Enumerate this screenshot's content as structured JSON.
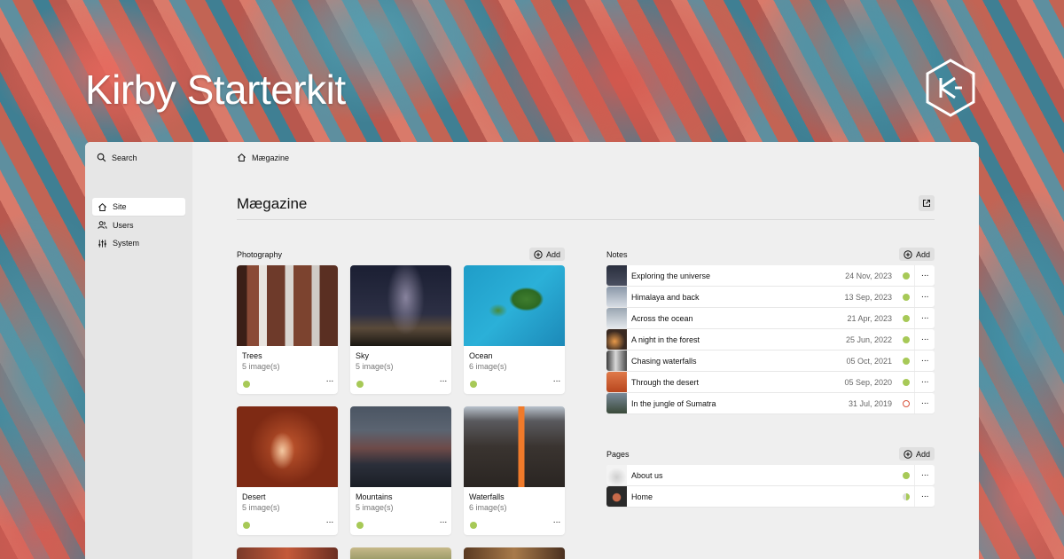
{
  "hero": {
    "title": "Kirby Starterkit"
  },
  "sidebar": {
    "search_label": "Search",
    "items": [
      {
        "label": "Site",
        "icon": "home-icon",
        "active": true
      },
      {
        "label": "Users",
        "icon": "users-icon",
        "active": false
      },
      {
        "label": "System",
        "icon": "settings-sliders-icon",
        "active": false
      }
    ]
  },
  "breadcrumb": {
    "label": "Mægazine"
  },
  "page": {
    "title": "Mægazine"
  },
  "photography": {
    "label": "Photography",
    "add_label": "Add",
    "cards": [
      {
        "title": "Trees",
        "info": "5 image(s)"
      },
      {
        "title": "Sky",
        "info": "5 image(s)"
      },
      {
        "title": "Ocean",
        "info": "6 image(s)"
      },
      {
        "title": "Desert",
        "info": "5 image(s)"
      },
      {
        "title": "Mountains",
        "info": "5 image(s)"
      },
      {
        "title": "Waterfalls",
        "info": "6 image(s)"
      }
    ]
  },
  "notes": {
    "label": "Notes",
    "add_label": "Add",
    "items": [
      {
        "title": "Exploring the universe",
        "date": "24 Nov, 2023",
        "status": "listed"
      },
      {
        "title": "Himalaya and back",
        "date": "13 Sep, 2023",
        "status": "listed"
      },
      {
        "title": "Across the ocean",
        "date": "21 Apr, 2023",
        "status": "listed"
      },
      {
        "title": "A night in the forest",
        "date": "25 Jun, 2022",
        "status": "listed"
      },
      {
        "title": "Chasing waterfalls",
        "date": "05 Oct, 2021",
        "status": "listed"
      },
      {
        "title": "Through the desert",
        "date": "05 Sep, 2020",
        "status": "listed"
      },
      {
        "title": "In the jungle of Sumatra",
        "date": "31 Jul, 2019",
        "status": "draft"
      }
    ]
  },
  "pages": {
    "label": "Pages",
    "add_label": "Add",
    "items": [
      {
        "title": "About us",
        "status": "listed"
      },
      {
        "title": "Home",
        "status": "unlisted"
      }
    ]
  },
  "more_label": "···",
  "colors": {
    "status_listed": "#a7c957",
    "status_draft": "#d9553e",
    "panel_bg": "#efefef"
  }
}
